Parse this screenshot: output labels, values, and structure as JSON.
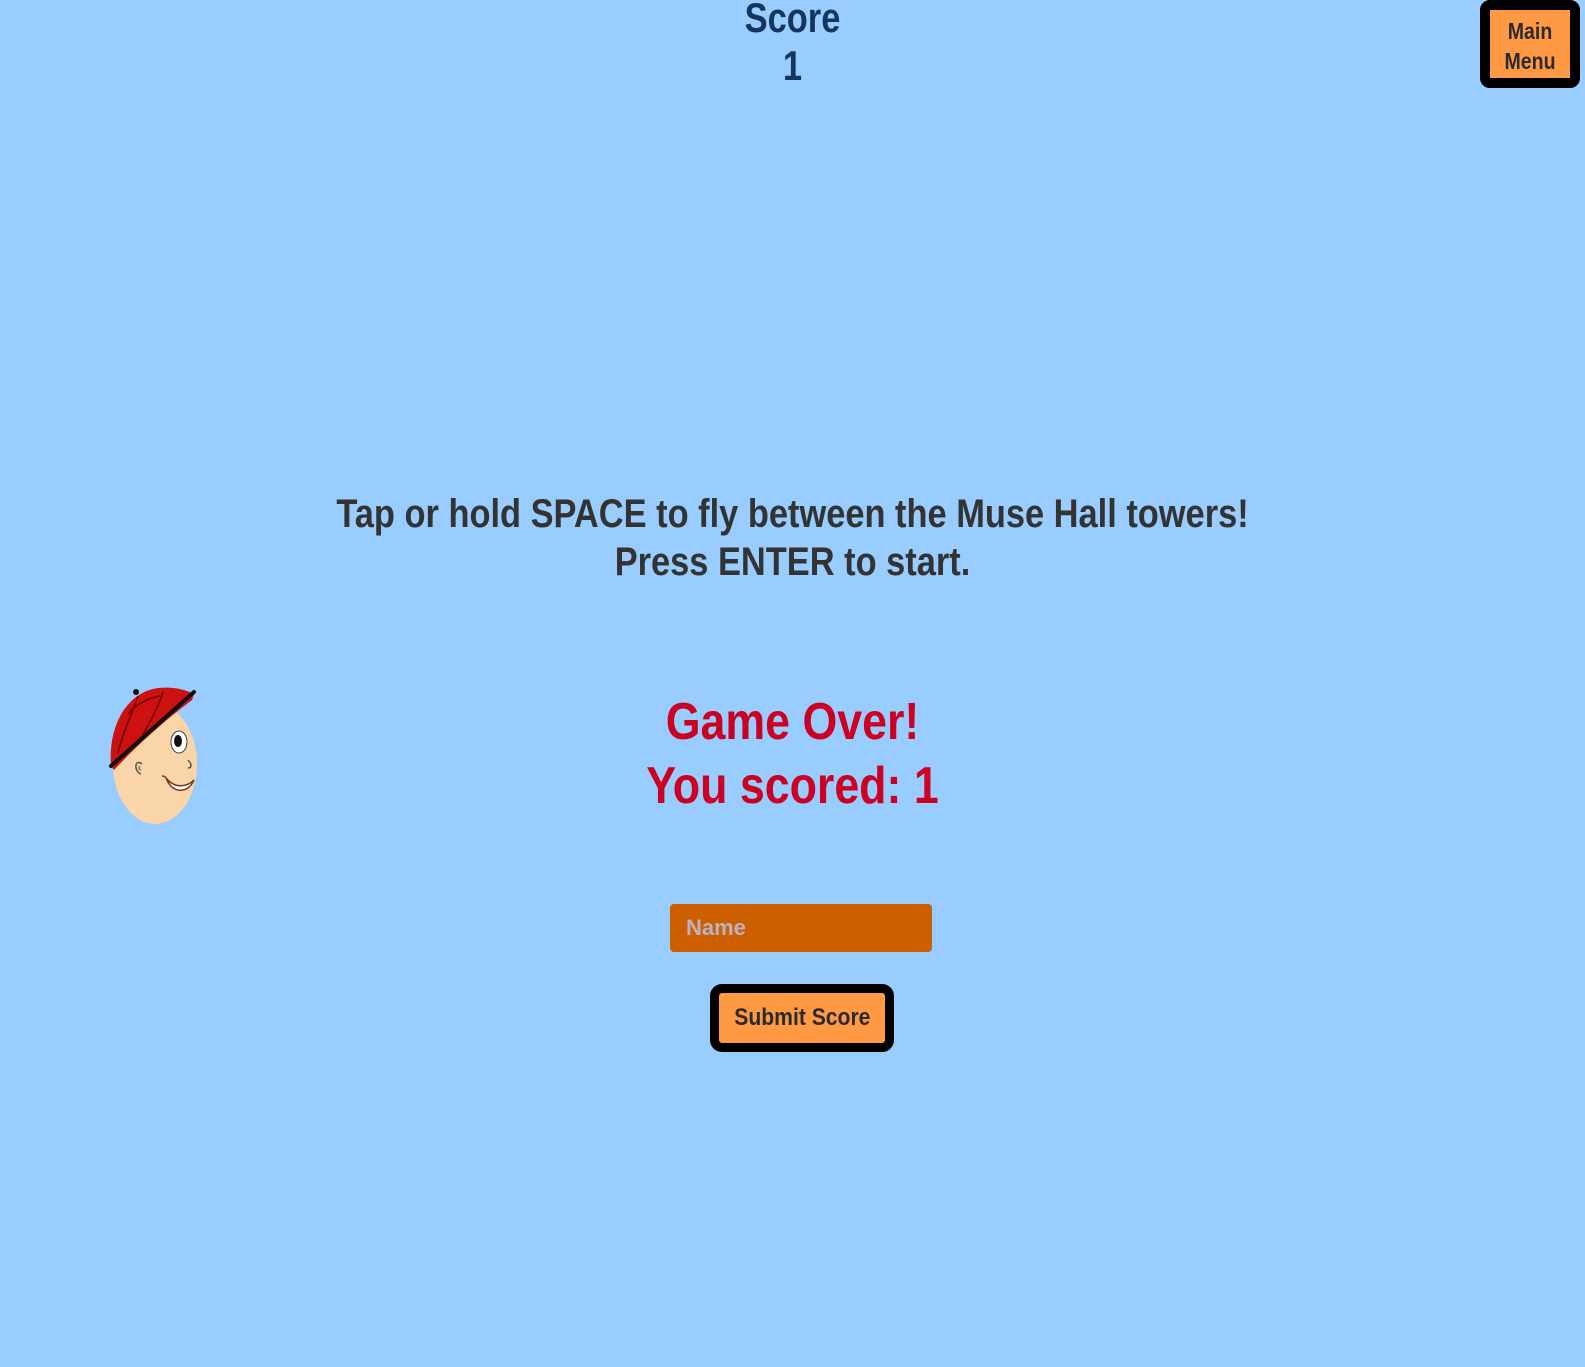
{
  "hud": {
    "score_label": "Score",
    "score_value": "1"
  },
  "menu": {
    "label_line1": "Main",
    "label_line2": "Menu"
  },
  "instructions": {
    "line1": "Tap or hold SPACE to fly between the Muse Hall towers!",
    "line2": "Press ENTER to start."
  },
  "game_over": {
    "title": "Game Over!",
    "result": "You scored: 1"
  },
  "form": {
    "name_placeholder": "Name",
    "name_value": "",
    "submit_label": "Submit Score"
  },
  "player": {
    "icon": "character-head-with-red-cap"
  },
  "colors": {
    "background": "#99ccff",
    "button": "#ff9944",
    "input": "#cc5f00",
    "game_over_text": "#cc0022",
    "score_text": "#14365e"
  }
}
